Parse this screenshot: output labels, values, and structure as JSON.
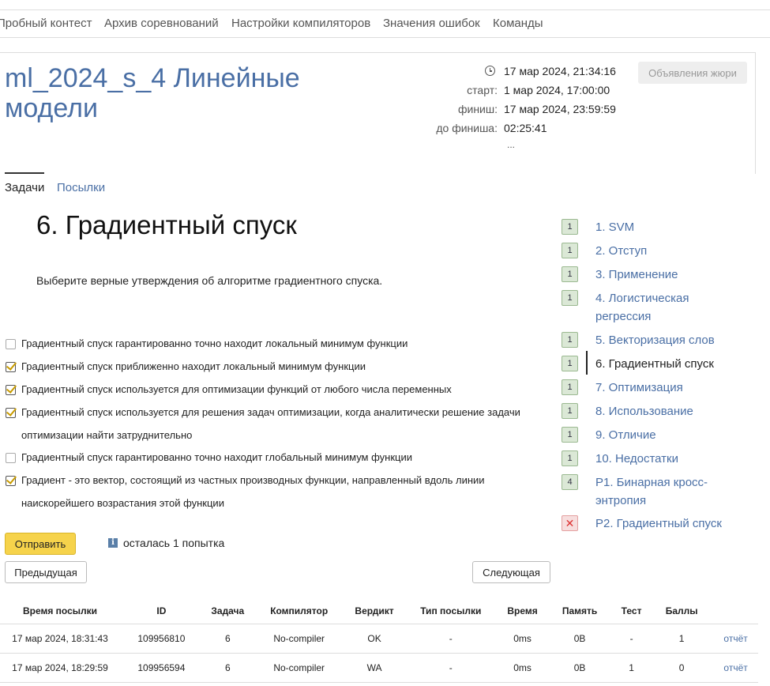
{
  "topnav": {
    "items": [
      "Пробный контест",
      "Архив соревнований",
      "Настройки компиляторов",
      "Значения ошибок",
      "Команды"
    ]
  },
  "contest": {
    "title": "ml_2024_s_4 Линейные модели",
    "now": "17 мар 2024, 21:34:16",
    "start_label": "старт:",
    "start": "1 мар 2024, 17:00:00",
    "finish_label": "финиш:",
    "finish": "17 мар 2024, 23:59:59",
    "left_label": "до финиша:",
    "left": "02:25:41",
    "more": "...",
    "jury_button": "Объявления жюри"
  },
  "tabs": [
    "Задачи",
    "Посылки"
  ],
  "problem": {
    "title": "6. Градиентный спуск",
    "description": "Выберите верные утверждения об алгоритме градиентного спуска.",
    "options": [
      {
        "lines": [
          "Градиентный спуск гарантированно точно находит локальный минимум функции"
        ],
        "checked": false
      },
      {
        "lines": [
          "Градиентный спуск приближенно находит локальный минимум функции"
        ],
        "checked": true
      },
      {
        "lines": [
          "Градиентный спуск используется для оптимизации функций от любого числа переменных"
        ],
        "checked": true
      },
      {
        "lines": [
          "Градиентный спуск используется для решения задач оптимизации, когда аналитически решение задачи",
          "оптимизации найти затруднительно"
        ],
        "checked": true
      },
      {
        "lines": [
          "Градиентный спуск гарантированно точно находит глобальный минимум функции"
        ],
        "checked": false
      },
      {
        "lines": [
          "Градиент - это вектор, состоящий из частных производных функции, направленный вдоль линии",
          "наискорейшего возрастания этой функции"
        ],
        "checked": true
      }
    ],
    "submit_button": "Отправить",
    "info_icon": "i",
    "attempts": "осталась 1 попытка",
    "prev_button": "Предыдущая",
    "next_button": "Следующая"
  },
  "problems": [
    {
      "badge": "1",
      "lines": [
        "1. SVM"
      ],
      "status": "ok"
    },
    {
      "badge": "1",
      "lines": [
        "2. Отступ"
      ],
      "status": "ok"
    },
    {
      "badge": "1",
      "lines": [
        "3. Применение"
      ],
      "status": "ok"
    },
    {
      "badge": "1",
      "lines": [
        "4. Логистическая",
        "регрессия"
      ],
      "status": "ok"
    },
    {
      "badge": "1",
      "lines": [
        "5. Векторизация слов"
      ],
      "status": "ok"
    },
    {
      "badge": "1",
      "lines": [
        "6. Градиентный спуск"
      ],
      "status": "ok",
      "current": true
    },
    {
      "badge": "1",
      "lines": [
        "7. Оптимизация"
      ],
      "status": "ok"
    },
    {
      "badge": "1",
      "lines": [
        "8. Использование"
      ],
      "status": "ok"
    },
    {
      "badge": "1",
      "lines": [
        "9. Отличие"
      ],
      "status": "ok"
    },
    {
      "badge": "1",
      "lines": [
        "10. Недостатки"
      ],
      "status": "ok"
    },
    {
      "badge": "4",
      "lines": [
        "P1. Бинарная кросс-",
        "энтропия"
      ],
      "status": "ok"
    },
    {
      "badge": "✕",
      "lines": [
        "P2. Градиентный спуск"
      ],
      "status": "fail"
    }
  ],
  "submissions": {
    "headers": [
      "Время посылки",
      "ID",
      "Задача",
      "Компилятор",
      "Вердикт",
      "Тип посылки",
      "Время",
      "Память",
      "Тест",
      "Баллы",
      ""
    ],
    "rows": [
      {
        "time": "17 мар 2024, 18:31:43",
        "id": "109956810",
        "task": "6",
        "compiler": "No-compiler",
        "verdict": "OK",
        "type": "-",
        "run_time": "0ms",
        "memory": "0B",
        "test": "-",
        "score": "1",
        "report": "отчёт"
      },
      {
        "time": "17 мар 2024, 18:29:59",
        "id": "109956594",
        "task": "6",
        "compiler": "No-compiler",
        "verdict": "WA",
        "type": "-",
        "run_time": "0ms",
        "memory": "0B",
        "test": "1",
        "score": "0",
        "report": "отчёт"
      }
    ]
  },
  "colors": {
    "link": "#4a6fa5",
    "ok": "#5a8a2e",
    "wa": "#e04b3a",
    "submit": "#f6d34b"
  }
}
